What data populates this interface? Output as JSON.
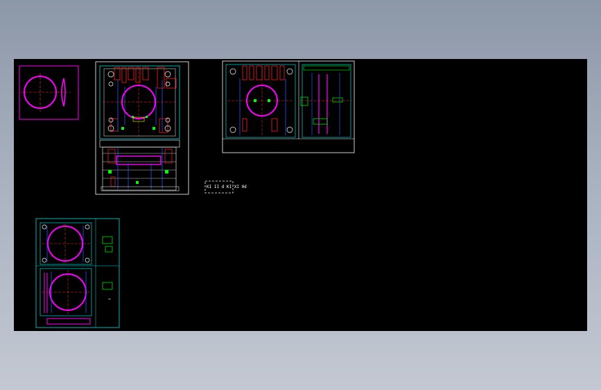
{
  "window": {
    "title": ""
  },
  "viewport": {
    "background": "#000000"
  },
  "colors": {
    "frame": "#ffffff",
    "magenta": "#ff00ff",
    "red": "#ff2020",
    "green": "#00ff00",
    "cyan": "#00ffff",
    "blue": "#2a55ff",
    "yellow": "#ffff00",
    "aqua_frame": "#00e0e0"
  },
  "drawings": [
    {
      "id": "part-view",
      "kind": "part drawing"
    },
    {
      "id": "mold-assembly",
      "kind": "assembly drawing"
    },
    {
      "id": "mold-plan-section",
      "kind": "plan and section drawing"
    },
    {
      "id": "plate-details",
      "kind": "plate detail drawing"
    }
  ],
  "title_block": {
    "text": "KI II d KI  XI 0d"
  }
}
